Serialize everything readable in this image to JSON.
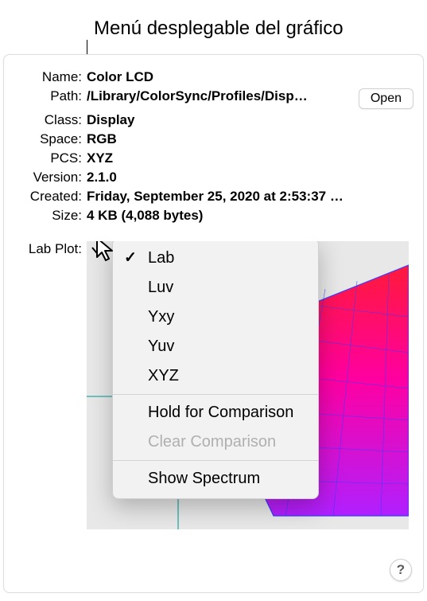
{
  "annotation": {
    "label": "Menú desplegable del gráfico"
  },
  "profile": {
    "labels": {
      "name": "Name:",
      "path": "Path:",
      "class": "Class:",
      "space": "Space:",
      "pcs": "PCS:",
      "version": "Version:",
      "created": "Created:",
      "size": "Size:",
      "lab_plot": "Lab Plot:"
    },
    "values": {
      "name": "Color LCD",
      "path": "/Library/ColorSync/Profiles/Disp…",
      "class": "Display",
      "space": "RGB",
      "pcs": "XYZ",
      "version": "2.1.0",
      "created": "Friday, September 25, 2020 at 2:53:37 P…",
      "size": "4 KB (4,088 bytes)"
    },
    "open_button": "Open"
  },
  "plot_menu": {
    "items": [
      {
        "label": "Lab",
        "checked": true,
        "enabled": true
      },
      {
        "label": "Luv",
        "checked": false,
        "enabled": true
      },
      {
        "label": "Yxy",
        "checked": false,
        "enabled": true
      },
      {
        "label": "Yuv",
        "checked": false,
        "enabled": true
      },
      {
        "label": "XYZ",
        "checked": false,
        "enabled": true
      }
    ],
    "extra": [
      {
        "label": "Hold for Comparison",
        "enabled": true
      },
      {
        "label": "Clear Comparison",
        "enabled": false
      }
    ],
    "spectrum": {
      "label": "Show Spectrum",
      "enabled": true
    }
  },
  "help_button": "?",
  "colors": {
    "grad_top": "#ff1a3a",
    "grad_bottom": "#e020e0",
    "axis": "#6fc1bd"
  }
}
